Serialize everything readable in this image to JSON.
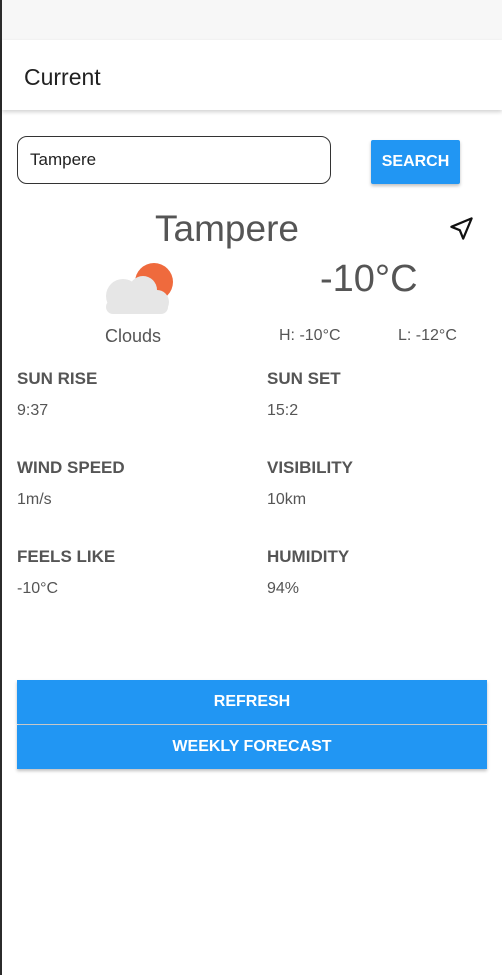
{
  "app_bar": {
    "title": "Current"
  },
  "search": {
    "value": "Tampere",
    "button_label": "SEARCH"
  },
  "weather": {
    "city": "Tampere",
    "temperature": "-10°C",
    "condition": "Clouds",
    "high": "H: -10°C",
    "low": "L: -12°C",
    "icon": "cloud-sun-icon"
  },
  "stats": {
    "sun_rise": {
      "label": "SUN RISE",
      "value": "9:37"
    },
    "sun_set": {
      "label": "SUN SET",
      "value": "15:2"
    },
    "wind_speed": {
      "label": "WIND SPEED",
      "value": "1m/s"
    },
    "visibility": {
      "label": "VISIBILITY",
      "value": "10km"
    },
    "feels_like": {
      "label": "FEELS LIKE",
      "value": "-10°C"
    },
    "humidity": {
      "label": "HUMIDITY",
      "value": "94%"
    }
  },
  "actions": {
    "refresh_label": "REFRESH",
    "weekly_label": "WEEKLY FORECAST"
  },
  "colors": {
    "accent": "#2196f3",
    "sun": "#ef6a3d",
    "cloud": "#e6e6e6"
  }
}
